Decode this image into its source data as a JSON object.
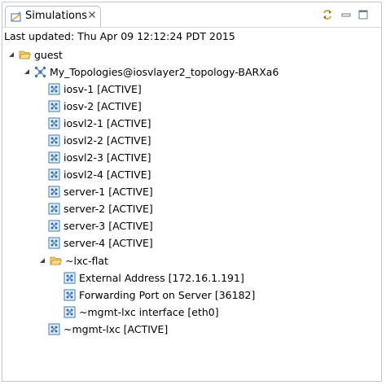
{
  "view": {
    "tab_label": "Simulations",
    "status_text": "Last updated: Thu Apr 09 12:12:24 PDT 2015"
  },
  "tree": {
    "root": {
      "label": "guest",
      "icon": "folder-open-icon"
    },
    "topology": {
      "label": "My_Topologies@iosvlayer2_topology-BARXa6",
      "icon": "topology-icon"
    },
    "nodes": [
      {
        "label": "iosv-1  [ACTIVE]"
      },
      {
        "label": "iosv-2  [ACTIVE]"
      },
      {
        "label": "iosvl2-1  [ACTIVE]"
      },
      {
        "label": "iosvl2-2  [ACTIVE]"
      },
      {
        "label": "iosvl2-3  [ACTIVE]"
      },
      {
        "label": "iosvl2-4  [ACTIVE]"
      },
      {
        "label": "server-1  [ACTIVE]"
      },
      {
        "label": "server-2  [ACTIVE]"
      },
      {
        "label": "server-3  [ACTIVE]"
      },
      {
        "label": "server-4  [ACTIVE]"
      }
    ],
    "lxc_folder": {
      "label": "~lxc-flat",
      "icon": "folder-open-icon"
    },
    "lxc_children": [
      {
        "label": "External Address  [172.16.1.191]"
      },
      {
        "label": "Forwarding Port on Server  [36182]"
      },
      {
        "label": "~mgmt-lxc interface  [eth0]"
      }
    ],
    "mgmt": {
      "label": "~mgmt-lxc  [ACTIVE]"
    }
  },
  "colors": {
    "accent": "#3c78b4",
    "folder": "#e9b84a",
    "border": "#c2c8d0"
  }
}
